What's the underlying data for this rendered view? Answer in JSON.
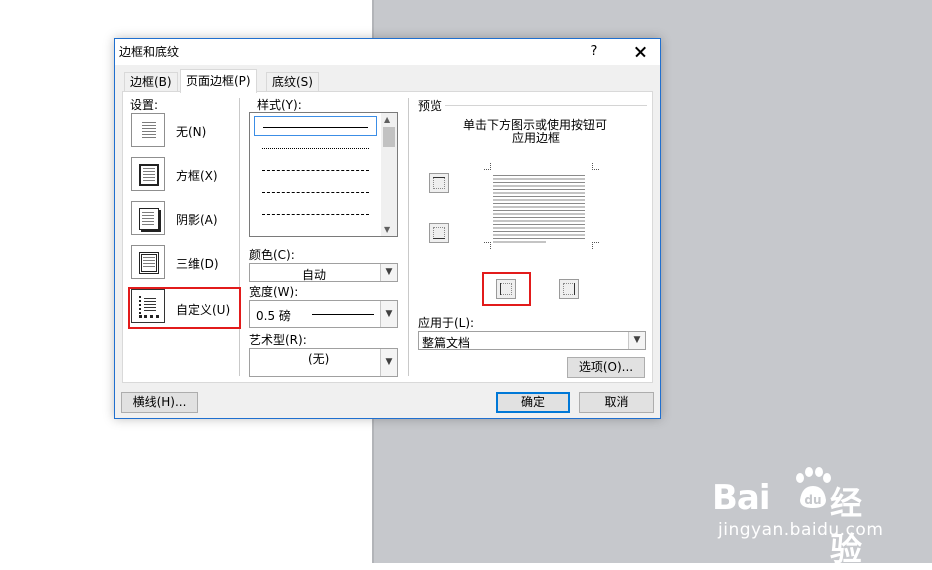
{
  "dialog": {
    "title": "边框和底纹",
    "help_label": "?",
    "tabs": [
      {
        "label": "边框(B)",
        "active": false
      },
      {
        "label": "页面边框(P)",
        "active": true
      },
      {
        "label": "底纹(S)",
        "active": false
      }
    ]
  },
  "settings": {
    "heading": "设置:",
    "items": [
      {
        "label": "无(N)",
        "icon": "setting-none-icon",
        "selected": false
      },
      {
        "label": "方框(X)",
        "icon": "setting-box-icon",
        "selected": false
      },
      {
        "label": "阴影(A)",
        "icon": "setting-shadow-icon",
        "selected": false
      },
      {
        "label": "三维(D)",
        "icon": "setting-3d-icon",
        "selected": false
      },
      {
        "label": "自定义(U)",
        "icon": "setting-custom-icon",
        "selected": true
      }
    ]
  },
  "style": {
    "heading": "样式(Y):",
    "items": [
      "solid",
      "dotted",
      "dashed-small",
      "dashed",
      "dash-dot"
    ],
    "selected_index": 0
  },
  "color": {
    "label": "颜色(C):",
    "value": "自动"
  },
  "width": {
    "label": "宽度(W):",
    "value": "0.5 磅"
  },
  "art": {
    "label": "艺术型(R):",
    "value": "(无)"
  },
  "preview": {
    "heading": "预览",
    "instruction_line1": "单击下方图示或使用按钮可",
    "instruction_line2": "应用边框"
  },
  "apply_to": {
    "label": "应用于(L):",
    "value": "整篇文档"
  },
  "buttons": {
    "options": "选项(O)...",
    "horizontal_line": "横线(H)...",
    "ok": "确定",
    "cancel": "取消"
  },
  "colors": {
    "highlight": "#e21b1b",
    "accent": "#0078d7",
    "document_gray": "#c6c8cc"
  },
  "watermark": {
    "logo_text": "Bai",
    "logo_text2": "经验",
    "url": "jingyan.baidu.com"
  }
}
